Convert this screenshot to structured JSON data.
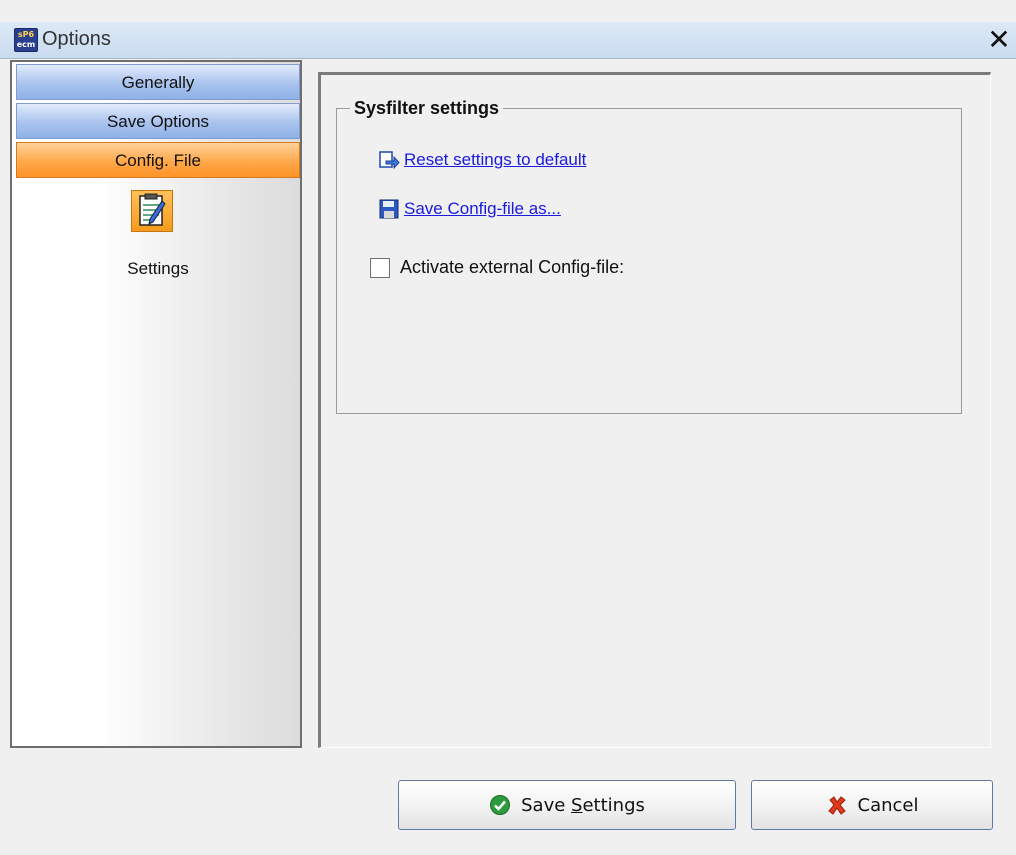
{
  "window": {
    "title": "Options",
    "app_icon_text_top": "sP6",
    "app_icon_text_bottom": "ecm",
    "close_glyph": "✕"
  },
  "sidebar": {
    "items": [
      {
        "label": "Generally",
        "state": "normal"
      },
      {
        "label": "Save Options",
        "state": "normal"
      },
      {
        "label": "Config. File",
        "state": "selected"
      }
    ],
    "page": {
      "icon": "notepad-icon",
      "label": "Settings"
    }
  },
  "main": {
    "group_title": "Sysfilter settings",
    "links": [
      {
        "label": "Reset settings to default",
        "icon": "reset-icon"
      },
      {
        "label": "Save Config-file as...",
        "icon": "floppy-icon"
      }
    ],
    "checkbox": {
      "label": "Activate external Config-file:",
      "checked": false
    }
  },
  "buttons": {
    "save": {
      "prefix": "Save ",
      "mnemonic": "S",
      "rest": "ettings",
      "icon": "check-icon"
    },
    "cancel": {
      "label": "Cancel",
      "icon": "x-icon"
    }
  },
  "colors": {
    "link": "#1a1ae0",
    "tab_blue": "#a9c3ee",
    "tab_selected_orange": "#ffa84a"
  }
}
